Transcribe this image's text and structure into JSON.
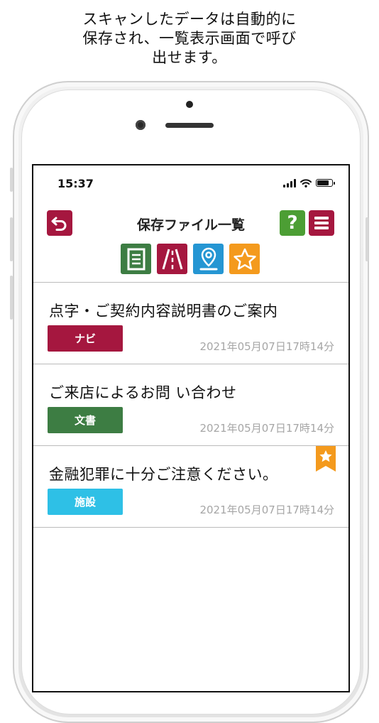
{
  "caption": {
    "line1": "スキャンしたデータは自動的に",
    "line2": "保存され、一覧表示画面で呼び",
    "line3": "出せます。"
  },
  "status_bar": {
    "time": "15:37"
  },
  "header": {
    "title": "保存ファイル一覧"
  },
  "icons": {
    "back": "back-arrow-icon",
    "help": "question-mark-icon",
    "menu": "hamburger-menu-icon",
    "filters": [
      "document-icon",
      "road-icon",
      "map-pin-icon",
      "star-icon"
    ],
    "bookmark": "star-bookmark-icon"
  },
  "items": [
    {
      "title": "点字・ご契約内容説明書のご案内",
      "tag": "ナビ",
      "date": "2021年05月07日17時14分",
      "favorite": false
    },
    {
      "title": "ご来店によるお問 い合わせ",
      "tag": "文書",
      "date": "2021年05月07日17時14分",
      "favorite": false
    },
    {
      "title": "金融犯罪に十分ご注意ください。",
      "tag": "施設",
      "date": "2021年05月07日17時14分",
      "favorite": true
    }
  ],
  "colors": {
    "crimson": "#a5173f",
    "green": "#3d7d43",
    "blue": "#2596d3",
    "orange": "#f49a1d",
    "cyan": "#2ec0e6",
    "help_green": "#4c9e34"
  }
}
